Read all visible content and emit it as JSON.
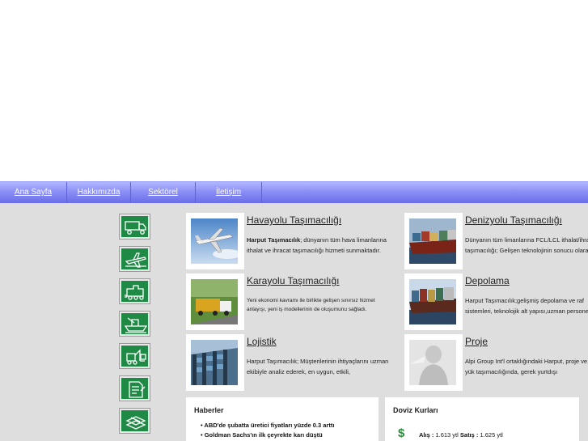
{
  "nav": {
    "items": [
      "Ana Sayfa",
      "Hakkımızda",
      "Sektörel",
      "İletişim"
    ]
  },
  "sidebar_icons": [
    "truck-icon",
    "airplane-icon",
    "train-icon",
    "ship-icon",
    "forklift-icon",
    "document-icon",
    "packages-icon"
  ],
  "cards": {
    "air": {
      "title": "Havayolu Taşımacılığı",
      "bold": "Harput Taşımacılık",
      "body": "; dünyanın tüm hava limanlarına ithalat ve ihracat taşımacılığı hizmeti sunmaktadır."
    },
    "sea": {
      "title": "Denizyolu Taşımacılığı",
      "body": "Dünyanın tüm limanlarına FCL/LCL ithalat/ihracat taşımacılığı; Gelişen teknolojinin sonucu olarak"
    },
    "road": {
      "title": "Karayolu Taşımacılığı",
      "body": "Yeni ekonomi kavramı ile birlikte gelişen sınırsız hizmet anlayışı, yeni iş modellerinin de oluşumunu sağladı."
    },
    "storage": {
      "title": "Depolama",
      "body": "Harput Taşımacılık;gelişmiş depolama ve raf sistemleri, teknolojik alt yapısı,uzman personeli"
    },
    "logistics": {
      "title": "Lojistik",
      "body": "Harput Taşımacılık; Müşterilerinin ihtiyaçlarını uzman ekibiyle analiz ederek, en uygun, etkili,"
    },
    "project": {
      "title": "Proje",
      "body": "Alpi Group Int'l ortaklığındaki Harput, proje ve ağır yük taşımacılığında, gerek yurtdışı"
    }
  },
  "news": {
    "title": "Haberler",
    "items": [
      "• ABD'de şubatta üretici fiyatları yüzde 0.3 arttı",
      "• Goldman Sachs'ın ilk çeyrekte karı düştü"
    ]
  },
  "currency": {
    "title": "Doviz Kurları",
    "symbol": "$",
    "buy_label": "Alış :",
    "buy_value": "1.613 ytl",
    "sell_label": "Satış :",
    "sell_value": "1.625 ytl"
  }
}
